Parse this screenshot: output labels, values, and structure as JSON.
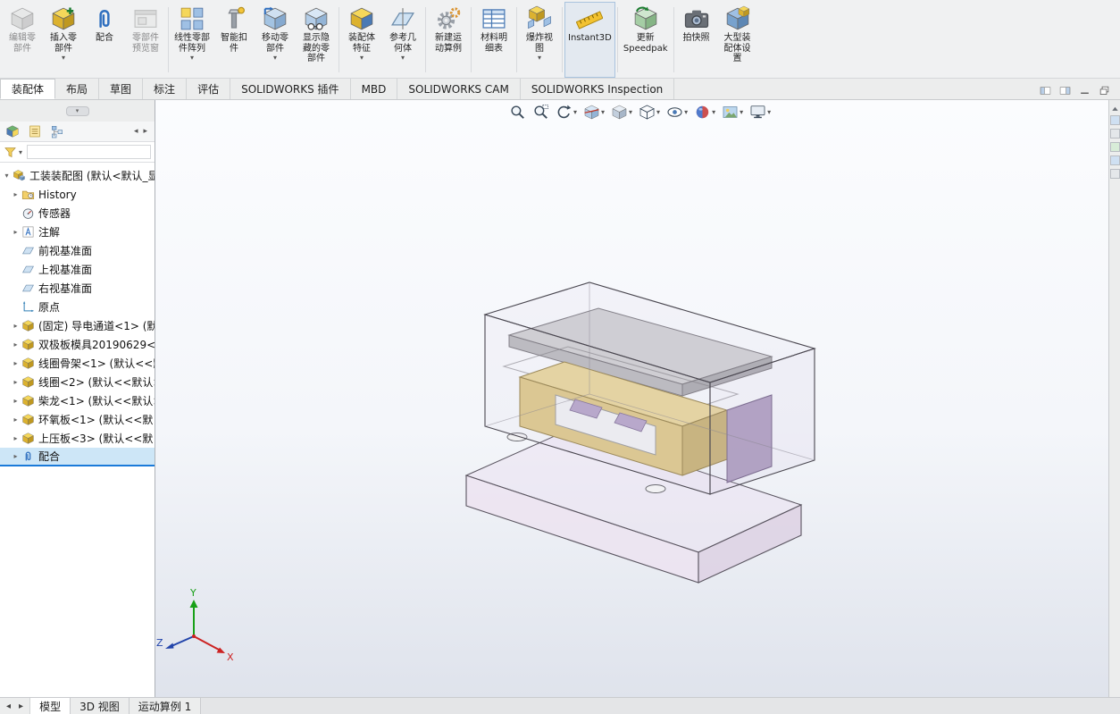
{
  "ribbon": {
    "buttons": [
      {
        "label": "编辑零\n部件",
        "icon": "edit-component-icon",
        "disabled": true
      },
      {
        "label": "插入零\n部件",
        "icon": "insert-component-icon",
        "dropdown": true
      },
      {
        "label": "配合",
        "icon": "mate-icon"
      },
      {
        "label": "零部件\n预览窗",
        "icon": "component-preview-icon",
        "disabled": true
      },
      {
        "label": "线性零部\n件阵列",
        "icon": "linear-pattern-icon",
        "dropdown": true,
        "sep": true
      },
      {
        "label": "智能扣\n件",
        "icon": "smart-fasteners-icon"
      },
      {
        "label": "移动零\n部件",
        "icon": "move-component-icon",
        "dropdown": true
      },
      {
        "label": "显示隐\n藏的零\n部件",
        "icon": "show-hidden-icon"
      },
      {
        "label": "装配体\n特征",
        "icon": "assembly-features-icon",
        "dropdown": true,
        "sep": true
      },
      {
        "label": "参考几\n何体",
        "icon": "reference-geometry-icon",
        "dropdown": true
      },
      {
        "label": "新建运\n动算例",
        "icon": "motion-study-icon",
        "sep": true
      },
      {
        "label": "材料明\n细表",
        "icon": "bom-icon",
        "sep": true
      },
      {
        "label": "爆炸视\n图",
        "icon": "exploded-view-icon",
        "dropdown": true,
        "sep": true
      },
      {
        "label": "Instant3D",
        "icon": "instant3d-icon",
        "sep": true,
        "pressed": true
      },
      {
        "label": "更新\nSpeedpak",
        "icon": "update-speedpak-icon",
        "sep": true
      },
      {
        "label": "拍快照",
        "icon": "snapshot-icon",
        "sep": true
      },
      {
        "label": "大型装\n配体设\n置",
        "icon": "large-assembly-icon"
      }
    ]
  },
  "command_tabs": {
    "items": [
      "装配体",
      "布局",
      "草图",
      "标注",
      "评估",
      "SOLIDWORKS 插件",
      "MBD",
      "SOLIDWORKS CAM",
      "SOLIDWORKS Inspection"
    ],
    "active": "装配体"
  },
  "window_controls": {
    "items": [
      "pane-left-icon",
      "pane-right-icon",
      "minimize-icon",
      "restore-icon"
    ]
  },
  "left_panel": {
    "tabs": [
      "featuremanager-tab-icon",
      "propertymanager-tab-icon",
      "configurationmanager-tab-icon"
    ],
    "flyout_arrows": [
      "chevron-left-icon",
      "chevron-right-icon"
    ],
    "filter_icon": "filter-icon",
    "filter_value": ""
  },
  "feature_tree": {
    "root": {
      "label": "工装装配图 (默认<默认_显",
      "icon": "assembly-icon",
      "expandable": true
    },
    "items": [
      {
        "label": "History",
        "icon": "history-icon",
        "expandable": true
      },
      {
        "label": "传感器",
        "icon": "sensors-icon"
      },
      {
        "label": "注解",
        "icon": "annotations-icon",
        "expandable": true
      },
      {
        "label": "前视基准面",
        "icon": "plane-icon"
      },
      {
        "label": "上视基准面",
        "icon": "plane-icon"
      },
      {
        "label": "右视基准面",
        "icon": "plane-icon"
      },
      {
        "label": "原点",
        "icon": "origin-icon"
      },
      {
        "label": "(固定) 导电通道<1> (默",
        "icon": "part-icon",
        "expandable": true
      },
      {
        "label": "双极板模具20190629<",
        "icon": "part-icon",
        "expandable": true
      },
      {
        "label": "线圈骨架<1> (默认<<默",
        "icon": "part-icon",
        "expandable": true
      },
      {
        "label": "线圈<2> (默认<<默认>",
        "icon": "part-icon",
        "expandable": true
      },
      {
        "label": "柴龙<1> (默认<<默认>",
        "icon": "part-icon",
        "expandable": true
      },
      {
        "label": "环氧板<1> (默认<<默",
        "icon": "part-icon",
        "expandable": true
      },
      {
        "label": "上压板<3> (默认<<默",
        "icon": "part-icon",
        "expandable": true
      },
      {
        "label": "配合",
        "icon": "mates-icon",
        "expandable": true,
        "selected": true
      }
    ]
  },
  "heads_up": {
    "items": [
      {
        "icon": "zoom-fit-icon"
      },
      {
        "icon": "zoom-area-icon"
      },
      {
        "icon": "previous-view-icon",
        "caret": true
      },
      {
        "icon": "section-view-icon",
        "caret": true
      },
      {
        "icon": "view-orientation-icon",
        "caret": true
      },
      {
        "icon": "display-style-icon",
        "caret": true
      },
      {
        "icon": "hide-show-items-icon",
        "caret": true
      },
      {
        "icon": "edit-appearance-icon",
        "caret": true
      },
      {
        "icon": "apply-scene-icon",
        "caret": true
      },
      {
        "icon": "view-settings-icon",
        "caret": true
      }
    ]
  },
  "bottom_bar": {
    "tabs": [
      "模型",
      "3D 视图",
      "运动算例 1"
    ],
    "active": "模型",
    "nav": [
      "tab-scroll-left-icon",
      "tab-scroll-right-icon"
    ]
  },
  "triad": {
    "x": "X",
    "y": "Y",
    "z": "Z",
    "x_color": "#cc2222",
    "y_color": "#18a018",
    "z_color": "#2244aa"
  }
}
